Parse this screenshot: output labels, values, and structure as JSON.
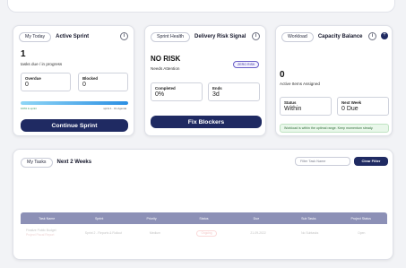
{
  "active_sprint": {
    "pill": "My Today",
    "title": "Active Sprint",
    "count": "1",
    "count_sub": "tasks due / in progress",
    "overdue_label": "Overdue",
    "overdue_value": "0",
    "blocked_label": "Blocked",
    "blocked_value": "0",
    "progress_fraction": 1.0,
    "progress_left_text": "100% in-sprint",
    "progress_right_text": "sprint 1 · On Agenda",
    "button": "Continue Sprint"
  },
  "risk": {
    "pill": "Sprint Health",
    "title": "Delivery Risk Signal",
    "status": "NO RISK",
    "status_sub": "Needs Attention",
    "badge": "ZERO RISK",
    "completed_label": "Completed",
    "completed_value": "0%",
    "ends_label": "Ends",
    "ends_value": "3d",
    "button": "Fix Blockers"
  },
  "capacity": {
    "pill": "Workload",
    "title": "Capacity Balance",
    "count": "0",
    "count_sub": "Active Items Assigned",
    "status_label": "Status",
    "status_value": "Within",
    "next_week_label": "Next Week",
    "next_week_value": "0 Due",
    "note": "Workload is within the optimal range. Keep momentum steady.",
    "dot_label": "+"
  },
  "tasks": {
    "pill": "My Tasks",
    "title": "Next 2 Weeks",
    "search_placeholder": "Filter Task Name",
    "clear_button": "Clear Filter",
    "columns": [
      "Task Name",
      "Sprint",
      "Priority",
      "Status",
      "Due",
      "Sub Tasks",
      "Project Status"
    ],
    "row": {
      "task_line1": "Finalize Public Budget",
      "task_line2": "Project Fiscal Report",
      "sprint": "Sprint 2 - Reports & Rollout",
      "priority": "Medium",
      "status": "Ongoing",
      "due": "21-09-2022",
      "subtasks": "No Subtasks",
      "project_status": "Open"
    }
  },
  "icons": {
    "info": "i"
  },
  "colors": {
    "primary": "#1f2a62",
    "table_header": "#8c90b6",
    "progress": "#2b8fe3"
  }
}
